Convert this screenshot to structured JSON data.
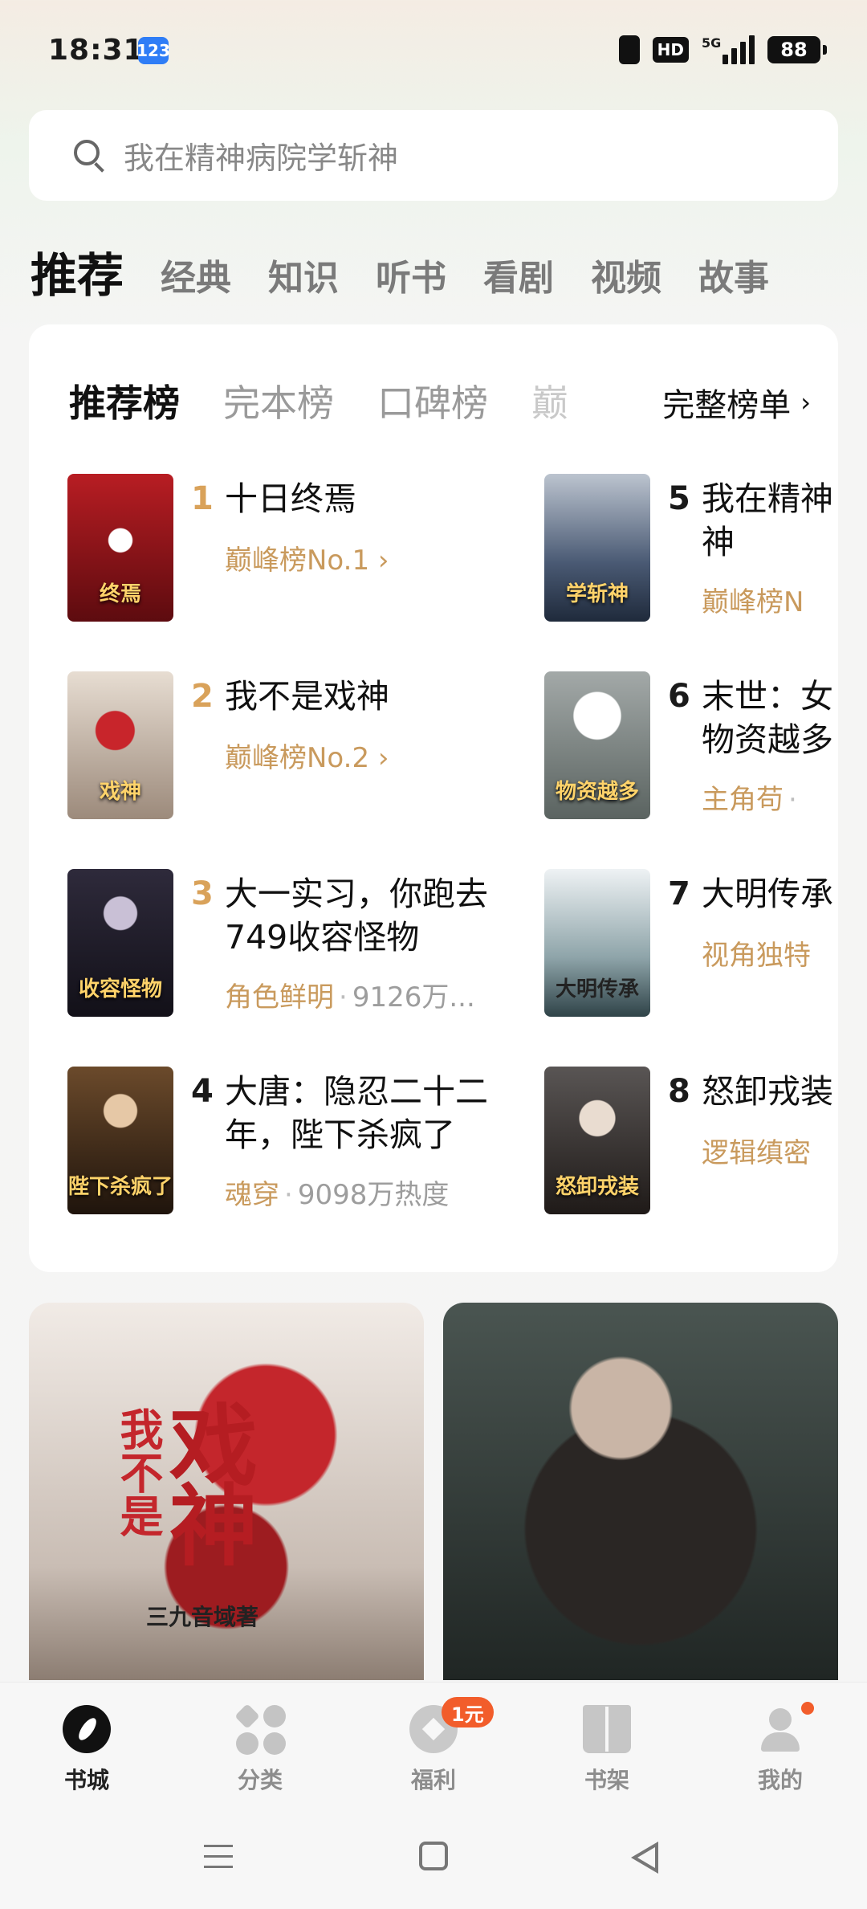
{
  "status": {
    "time": "18:31",
    "notification_badge": "123",
    "hd": "HD",
    "network": "5G",
    "battery": "88"
  },
  "search": {
    "placeholder": "我在精神病院学斩神"
  },
  "tabs": [
    "推荐",
    "经典",
    "知识",
    "听书",
    "看剧",
    "视频",
    "故事"
  ],
  "ranking": {
    "tabs": [
      "推荐榜",
      "完本榜",
      "口碑榜",
      "巅"
    ],
    "full_list_label": "完整榜单",
    "items": [
      {
        "rank": "1",
        "title": "十日终焉",
        "meta": "巅峰榜No.1 ›",
        "cover_text": "终焉"
      },
      {
        "rank": "2",
        "title": "我不是戏神",
        "meta": "巅峰榜No.2 ›",
        "cover_text": "戏神"
      },
      {
        "rank": "3",
        "title": "大一实习，你跑去749收容怪物",
        "tag": "角色鲜明",
        "heat": "9126万...",
        "cover_text": "收容怪物"
      },
      {
        "rank": "4",
        "title": "大唐：隐忍二十二年，陛下杀疯了",
        "tag": "魂穿",
        "heat": "9098万热度",
        "cover_text": "陛下杀疯了"
      },
      {
        "rank": "5",
        "title": "我在精神",
        "title2": "神",
        "meta": "巅峰榜N",
        "cover_text": "学斩神"
      },
      {
        "rank": "6",
        "title": "末世：女",
        "title2": "物资越多",
        "tag": "主角苟",
        "cover_text": "物资越多"
      },
      {
        "rank": "7",
        "title": "大明传承",
        "meta": "视角独特",
        "cover_text": "大明传承"
      },
      {
        "rank": "8",
        "title": "怒卸戎装",
        "meta": "逻辑缜密",
        "cover_text": "怒卸戎装"
      }
    ]
  },
  "features": [
    {
      "title": "戏神",
      "subtitle": "我不是",
      "author": "三九音域著"
    },
    {
      "title": "",
      "subtitle": "",
      "author": ""
    }
  ],
  "bottom_nav": [
    {
      "label": "书城",
      "active": true
    },
    {
      "label": "分类"
    },
    {
      "label": "福利",
      "badge": "1元"
    },
    {
      "label": "书架"
    },
    {
      "label": "我的"
    }
  ],
  "colors": {
    "accent": "#d9a25a",
    "badge": "#f25d2b"
  }
}
